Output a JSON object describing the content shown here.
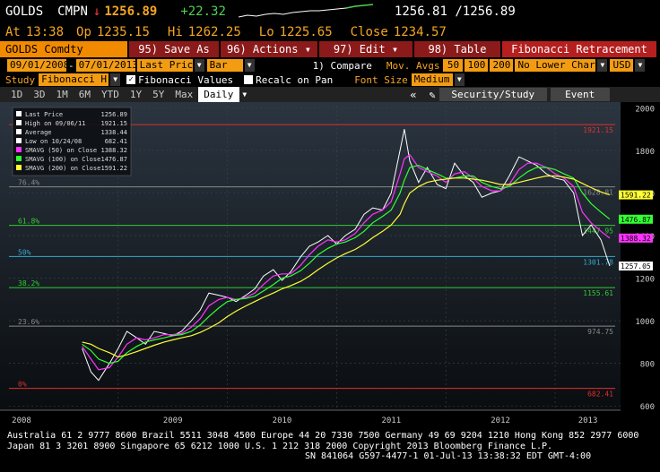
{
  "ticker": {
    "symbol": "GOLDS",
    "cmpn": "CMPN",
    "arrow": "↓",
    "last": "1256.89",
    "change": "+22.32",
    "bid_ask": "1256.81 /1256.89",
    "at_label": "At",
    "at_time": "13:38",
    "op_label": "Op",
    "open": "1235.15",
    "hi_label": "Hi",
    "high": "1262.25",
    "lo_label": "Lo",
    "low": "1225.65",
    "close_label": "Close",
    "close": "1234.57"
  },
  "toolbar": {
    "security": "GOLDS Comdty",
    "save": "95) Save As",
    "actions": "96) Actions ▾",
    "edit": "97) Edit ▾",
    "table": "98) Table",
    "study_title": "Fibonacci Retracement"
  },
  "controls": {
    "start_date": "09/01/2008",
    "end_date": "07/01/2013",
    "price_field": "Last Price",
    "chart_type": "Bar",
    "compare": "1) Compare",
    "mov_avgs": "Mov. Avgs",
    "ma1": "50",
    "ma2": "100",
    "ma3": "200",
    "lower_chart": "No Lower Chart",
    "currency": "USD"
  },
  "study": {
    "label": "Study",
    "value": "Fibonacci H-L",
    "fib_values": "Fibonacci Values",
    "recalc": "Recalc on Pan",
    "font_label": "Font Size",
    "font_value": "Medium"
  },
  "periods": {
    "items": [
      "1D",
      "3D",
      "1M",
      "6M",
      "YTD",
      "1Y",
      "5Y",
      "Max"
    ],
    "frequency": "Daily",
    "security_study": "Security/Study",
    "event": "Event"
  },
  "chart_data": {
    "type": "line",
    "ylim": [
      580,
      2010
    ],
    "yticks": [
      600,
      800,
      1000,
      1200,
      1400,
      1600,
      1800,
      2000
    ],
    "xlabels": [
      "2008",
      "2009",
      "2010",
      "2011",
      "2012",
      "2013"
    ],
    "legend": [
      {
        "label": "Last Price",
        "value": "1256.89",
        "color": "#ffffff"
      },
      {
        "label": "High on 09/06/11",
        "value": "1921.15",
        "color": "#ffffff"
      },
      {
        "label": "Average",
        "value": "1338.44",
        "color": "#ffffff"
      },
      {
        "label": "Low on 10/24/08",
        "value": "682.41",
        "color": "#ffffff"
      },
      {
        "label": "SMAVG (50) on Close",
        "value": "1388.32",
        "color": "#ff33ff"
      },
      {
        "label": "SMAVG (100) on Close",
        "value": "1476.87",
        "color": "#33ff33"
      },
      {
        "label": "SMAVG (200) on Close",
        "value": "1591.22",
        "color": "#ffff33"
      }
    ],
    "fib_levels": [
      {
        "pct": "",
        "value": 1921.15,
        "label": "1921.15",
        "color": "#e03030"
      },
      {
        "pct": "76.4%",
        "value": 1628.81,
        "label": "1628.81",
        "color": "#888888"
      },
      {
        "pct": "61.8%",
        "value": 1447.95,
        "label": "1447.95",
        "color": "#33cc33"
      },
      {
        "pct": "50%",
        "value": 1301.78,
        "label": "1301.78",
        "color": "#33aacc"
      },
      {
        "pct": "38.2%",
        "value": 1155.61,
        "label": "1155.61",
        "color": "#33cc33"
      },
      {
        "pct": "23.6%",
        "value": 974.75,
        "label": "974.75",
        "color": "#888888"
      },
      {
        "pct": "0%",
        "value": 682.41,
        "label": "682.41",
        "color": "#e03030"
      }
    ],
    "tags": [
      {
        "value": 1591.22,
        "label": "1591.22",
        "bg": "#ffff33",
        "fg": "#000000"
      },
      {
        "value": 1476.87,
        "label": "1476.87",
        "bg": "#33ff33",
        "fg": "#000000"
      },
      {
        "value": 1388.32,
        "label": "1388.32",
        "bg": "#ff33ff",
        "fg": "#000000"
      },
      {
        "value": 1257.05,
        "label": "1257.05",
        "bg": "#ffffff",
        "fg": "#000000"
      }
    ],
    "x": [
      2008.67,
      2008.75,
      2008.82,
      2008.92,
      2009.0,
      2009.08,
      2009.17,
      2009.25,
      2009.33,
      2009.42,
      2009.5,
      2009.58,
      2009.67,
      2009.75,
      2009.83,
      2009.92,
      2010.0,
      2010.08,
      2010.17,
      2010.25,
      2010.33,
      2010.42,
      2010.5,
      2010.58,
      2010.67,
      2010.75,
      2010.83,
      2010.92,
      2011.0,
      2011.08,
      2011.17,
      2011.25,
      2011.33,
      2011.42,
      2011.5,
      2011.58,
      2011.62,
      2011.67,
      2011.75,
      2011.83,
      2011.92,
      2012.0,
      2012.08,
      2012.17,
      2012.25,
      2012.33,
      2012.42,
      2012.5,
      2012.58,
      2012.67,
      2012.75,
      2012.83,
      2012.92,
      2013.0,
      2013.08,
      2013.17,
      2013.25,
      2013.33,
      2013.42,
      2013.5
    ],
    "series": [
      {
        "name": "Last Price",
        "color": "#ffffff",
        "values": [
          870,
          760,
          720,
          800,
          870,
          950,
          920,
          890,
          950,
          940,
          930,
          950,
          1000,
          1050,
          1130,
          1120,
          1110,
          1090,
          1120,
          1150,
          1210,
          1240,
          1190,
          1230,
          1300,
          1350,
          1370,
          1400,
          1360,
          1400,
          1430,
          1500,
          1530,
          1520,
          1600,
          1800,
          1900,
          1750,
          1650,
          1720,
          1640,
          1620,
          1740,
          1680,
          1650,
          1580,
          1600,
          1610,
          1680,
          1770,
          1750,
          1730,
          1690,
          1670,
          1660,
          1600,
          1400,
          1450,
          1380,
          1257
        ]
      },
      {
        "name": "SMAVG (50) on Close",
        "color": "#ff33ff",
        "values": [
          880,
          820,
          770,
          780,
          830,
          890,
          920,
          910,
          920,
          935,
          935,
          940,
          970,
          1010,
          1070,
          1100,
          1110,
          1100,
          1110,
          1130,
          1170,
          1210,
          1220,
          1220,
          1260,
          1310,
          1350,
          1380,
          1370,
          1380,
          1410,
          1460,
          1500,
          1520,
          1560,
          1690,
          1760,
          1780,
          1720,
          1700,
          1680,
          1650,
          1690,
          1700,
          1670,
          1630,
          1610,
          1610,
          1640,
          1710,
          1740,
          1740,
          1720,
          1690,
          1670,
          1630,
          1510,
          1460,
          1420,
          1388
        ]
      },
      {
        "name": "SMAVG (100) on Close",
        "color": "#33ff33",
        "values": [
          890,
          860,
          820,
          800,
          810,
          850,
          880,
          900,
          910,
          920,
          930,
          935,
          950,
          980,
          1020,
          1060,
          1090,
          1100,
          1105,
          1115,
          1140,
          1170,
          1200,
          1210,
          1235,
          1270,
          1310,
          1340,
          1360,
          1370,
          1390,
          1420,
          1460,
          1490,
          1520,
          1600,
          1660,
          1720,
          1730,
          1710,
          1690,
          1670,
          1670,
          1680,
          1680,
          1650,
          1630,
          1620,
          1630,
          1670,
          1700,
          1720,
          1720,
          1710,
          1690,
          1670,
          1600,
          1550,
          1510,
          1477
        ]
      },
      {
        "name": "SMAVG (200) on Close",
        "color": "#ffff33",
        "values": [
          900,
          890,
          870,
          850,
          830,
          840,
          855,
          870,
          885,
          900,
          910,
          920,
          930,
          945,
          965,
          990,
          1020,
          1045,
          1070,
          1090,
          1110,
          1130,
          1150,
          1165,
          1185,
          1210,
          1240,
          1270,
          1295,
          1315,
          1335,
          1360,
          1390,
          1420,
          1450,
          1500,
          1550,
          1600,
          1630,
          1650,
          1660,
          1665,
          1670,
          1670,
          1665,
          1660,
          1650,
          1640,
          1640,
          1650,
          1660,
          1670,
          1680,
          1680,
          1675,
          1665,
          1645,
          1625,
          1605,
          1591
        ]
      }
    ]
  },
  "footer": {
    "line1": "Australia 61 2 9777 8600 Brazil 5511 3048 4500 Europe 44 20 7330 7500 Germany 49 69 9204 1210 Hong Kong 852 2977 6000",
    "line2": "Japan 81 3 3201 8900       Singapore 65 6212 1000       U.S. 1 212 318 2000     Copyright 2013 Bloomberg Finance L.P.",
    "line3": "SN 841064 G597-4477-1 01-Jul-13 13:38:32 EDT  GMT-4:00"
  }
}
